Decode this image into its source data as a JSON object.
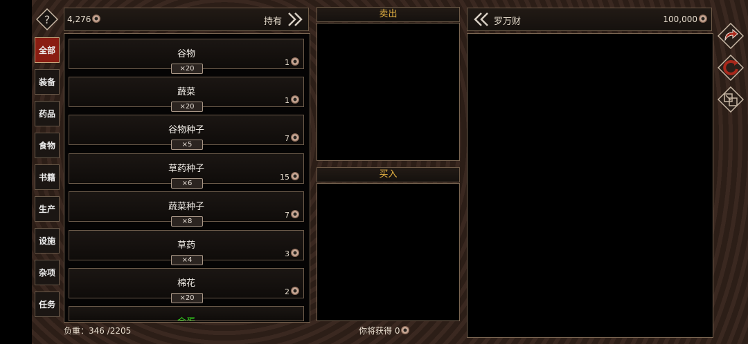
{
  "player": {
    "money": "4,276",
    "hold_label": "持有"
  },
  "categories": [
    "全部",
    "装备",
    "药品",
    "食物",
    "书籍",
    "生产",
    "设施",
    "杂项",
    "任务"
  ],
  "items": [
    {
      "name": "谷物",
      "qty": "×20",
      "price": "1"
    },
    {
      "name": "蔬菜",
      "qty": "×20",
      "price": "1"
    },
    {
      "name": "谷物种子",
      "qty": "×5",
      "price": "7"
    },
    {
      "name": "草药种子",
      "qty": "×6",
      "price": "15"
    },
    {
      "name": "蔬菜种子",
      "qty": "×8",
      "price": "7"
    },
    {
      "name": "草药",
      "qty": "×4",
      "price": "3"
    },
    {
      "name": "棉花",
      "qty": "×20",
      "price": "2"
    },
    {
      "name": "金蛋"
    }
  ],
  "weight": {
    "label": "负重：",
    "value": "346 /2205"
  },
  "trade": {
    "sell_label": "卖出",
    "buy_label": "买入",
    "gain_label": "你将获得",
    "gain_value": "0"
  },
  "merchant": {
    "name": "罗万财",
    "money": "100,000"
  },
  "icons": {
    "help": "question-icon",
    "arrow_right": "double-chevron-right-icon",
    "arrow_left": "double-chevron-left-icon",
    "side1": "redo-arrow-icon",
    "side2": "refresh-icon",
    "side3": "swap-window-icon"
  },
  "colors": {
    "accent_red": "#8a1d12",
    "title_yellow": "#e7b443",
    "green_item": "#34d11e"
  }
}
